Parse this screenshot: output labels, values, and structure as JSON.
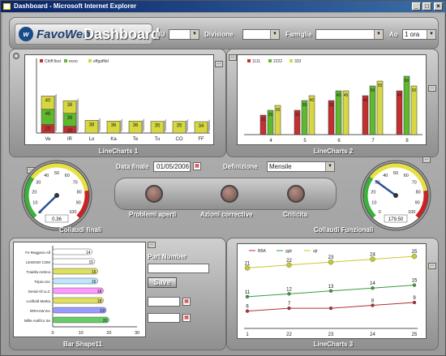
{
  "window": {
    "title": "Dashboard - Microsoft Internet Explorer"
  },
  "header": {
    "logo_favo": "FavoWeb",
    "logo_dash": "Dashboard",
    "filters": [
      {
        "label": "BU",
        "value": ""
      },
      {
        "label": "Divisione",
        "value": ""
      },
      {
        "label": "Famiglie",
        "value": ""
      },
      {
        "label": "Ao",
        "value": "1 ora"
      }
    ]
  },
  "chart1": {
    "title": "LineCharts 1",
    "legend": [
      "Chiff.fisci",
      "ecoo",
      "effgaffiid"
    ],
    "colors": {
      "red": "#c23030",
      "green": "#5fb82e",
      "yellow": "#d7d840"
    },
    "chart_data": {
      "type": "bar",
      "stacked": true,
      "categories": [
        "Ve",
        "IR",
        "Lo",
        "Ka",
        "Te",
        "Tu",
        "CO",
        "FF"
      ],
      "series": [
        {
          "name": "Chiff.fisci",
          "values": [
            25,
            20,
            0,
            0,
            0,
            0,
            0,
            0
          ]
        },
        {
          "name": "ecoo",
          "values": [
            46,
            39,
            0,
            0,
            0,
            0,
            0,
            0
          ]
        },
        {
          "name": "effgaffiid",
          "values": [
            40,
            38,
            38,
            36,
            36,
            35,
            35,
            34
          ]
        }
      ],
      "value_labels": [
        [
          "25",
          "46",
          "40"
        ],
        [
          "20",
          "39",
          "38"
        ],
        [
          "",
          "",
          "38"
        ],
        [
          "",
          "",
          "36"
        ],
        [
          "",
          "",
          "36"
        ],
        [
          "",
          "",
          "35"
        ],
        [
          "",
          "",
          "35"
        ],
        [
          "",
          "",
          "34"
        ]
      ],
      "ylim": [
        0,
        90
      ]
    }
  },
  "chart2": {
    "title": "LineCharts 2",
    "legend": [
      "1111",
      "2222",
      "333"
    ],
    "chart_data": {
      "type": "bar",
      "categories": [
        "4",
        "5",
        "6",
        "7",
        "8"
      ],
      "series": [
        {
          "name": "1111",
          "values": [
            20,
            25,
            35,
            40,
            45
          ]
        },
        {
          "name": "2222",
          "values": [
            25,
            35,
            45,
            50,
            60
          ]
        },
        {
          "name": "333",
          "values": [
            30,
            40,
            45,
            55,
            50
          ]
        }
      ],
      "ylim": [
        0,
        70
      ]
    }
  },
  "gauge1": {
    "title": "Collaudi finali",
    "value": "0.36",
    "value_num": 0.36,
    "ticks": [
      "0",
      "10",
      "20",
      "30",
      "40",
      "50",
      "60",
      "70",
      "80",
      "90",
      "100"
    ]
  },
  "gauge2": {
    "title": "Collaudi Funzionali",
    "value": "179.50",
    "value_num": 30,
    "ticks": [
      "0",
      "10",
      "20",
      "30",
      "40",
      "50",
      "60",
      "70",
      "80",
      "90",
      "100"
    ]
  },
  "controls": {
    "data_finale_label": "Data finale",
    "data_finale_value": "01/05/2006",
    "definizione_label": "Definizione",
    "definizione_value": "Mensile",
    "buttons": [
      "Problemi aperti",
      "Azioni corrective",
      "Criticita"
    ]
  },
  "chart3": {
    "title": "Bar Shape11",
    "chart_data": {
      "type": "bar",
      "orientation": "horizontal",
      "categories": [
        "Fe Reggece Alf",
        "LEIGINO COM",
        "Traiella Aetrica",
        "Tripno tec",
        "Gerial All LLC",
        "Lorifield Marka",
        "IRRAAW tec",
        "Nillie Autifico Se"
      ],
      "values": [
        14,
        15,
        16,
        16,
        18,
        18,
        19,
        20
      ],
      "colors": [
        "#ffffff",
        "#ffffff",
        "#e0e060",
        "#bfe6ff",
        "#ff99ff",
        "#e0e060",
        "#9999ff",
        "#66cc66"
      ],
      "xticks": [
        "0",
        "10",
        "20",
        "30"
      ],
      "xlim": [
        0,
        30
      ]
    },
    "part_number_label": "Part Number",
    "save_label": "Save"
  },
  "chart4": {
    "title": "LineCharts 3",
    "legend": [
      "BBA",
      "ggk",
      "ajt"
    ],
    "chart_data": {
      "type": "line",
      "x": [
        "1",
        "22",
        "23",
        "24",
        "25"
      ],
      "series": [
        {
          "name": "BBA",
          "values": [
            6,
            7,
            7,
            8,
            9
          ],
          "color": "#b03030",
          "labels": [
            "6",
            "7",
            "",
            "8",
            "9"
          ]
        },
        {
          "name": "ggk",
          "values": [
            11,
            12,
            13,
            14,
            15
          ],
          "color": "#3a9a3a",
          "labels": [
            "11",
            "12",
            "13",
            "14",
            "15"
          ]
        },
        {
          "name": "ajt",
          "values": [
            21,
            22,
            23,
            24,
            25
          ],
          "color": "#c8c830",
          "labels": [
            "21",
            "22",
            "23",
            "24",
            "25"
          ]
        }
      ],
      "ylim": [
        0,
        27
      ]
    }
  }
}
